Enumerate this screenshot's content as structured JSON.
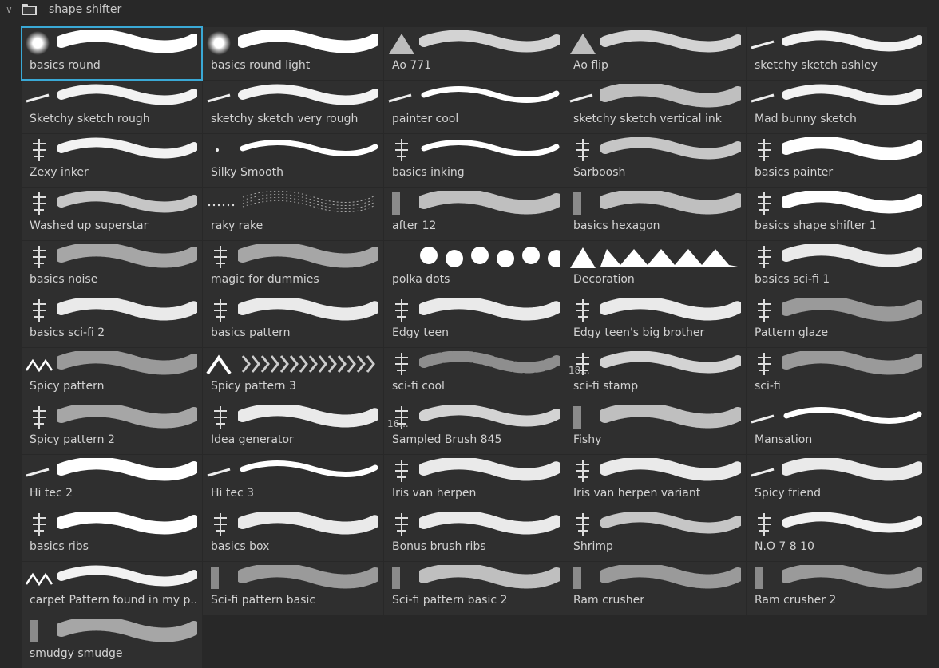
{
  "folder": {
    "title": "shape shifter",
    "expanded": true,
    "icon": "folder-icon",
    "chevron_icon": "chevron-down-icon"
  },
  "selected_index": 0,
  "accent_color": "#3aa9d6",
  "brushes": [
    {
      "name": "basics round",
      "tip": "soft-round",
      "stroke": "solid"
    },
    {
      "name": "basics round light",
      "tip": "soft-round",
      "stroke": "solid"
    },
    {
      "name": "Ao 771",
      "tip": "triangle",
      "stroke": "soft"
    },
    {
      "name": "Ao flip",
      "tip": "triangle",
      "stroke": "soft"
    },
    {
      "name": "sketchy sketch ashley",
      "tip": "sketch",
      "stroke": "rough"
    },
    {
      "name": "Sketchy sketch rough",
      "tip": "sketch",
      "stroke": "rough"
    },
    {
      "name": "sketchy sketch very rough",
      "tip": "sketch",
      "stroke": "rough"
    },
    {
      "name": "painter cool",
      "tip": "sketch",
      "stroke": "thin"
    },
    {
      "name": "sketchy sketch vertical ink",
      "tip": "sketch",
      "stroke": "speckle"
    },
    {
      "name": "Mad bunny sketch",
      "tip": "sketch",
      "stroke": "rough"
    },
    {
      "name": "Zexy inker",
      "tip": "glyph",
      "stroke": "rough"
    },
    {
      "name": "Silky Smooth",
      "tip": "dot",
      "stroke": "thin"
    },
    {
      "name": "basics inking",
      "tip": "glyph",
      "stroke": "thin"
    },
    {
      "name": "Sarboosh",
      "tip": "glyph",
      "stroke": "streaks"
    },
    {
      "name": "basics painter",
      "tip": "glyph",
      "stroke": "solid"
    },
    {
      "name": "Washed up superstar",
      "tip": "glyph",
      "stroke": "streaks"
    },
    {
      "name": "raky rake",
      "tip": "dots-row",
      "stroke": "rake"
    },
    {
      "name": "after 12",
      "tip": "texture",
      "stroke": "speckle"
    },
    {
      "name": "basics hexagon",
      "tip": "texture",
      "stroke": "speckle"
    },
    {
      "name": "basics shape shifter 1",
      "tip": "glyph",
      "stroke": "solid"
    },
    {
      "name": "basics noise",
      "tip": "glyph",
      "stroke": "noise"
    },
    {
      "name": "magic for dummies",
      "tip": "glyph",
      "stroke": "noise"
    },
    {
      "name": "polka dots",
      "tip": "none",
      "stroke": "dots"
    },
    {
      "name": "Decoration",
      "tip": "triangle-solid",
      "stroke": "zigzag"
    },
    {
      "name": "basics sci-fi 1",
      "tip": "glyph",
      "stroke": "pattern"
    },
    {
      "name": "basics sci-fi 2",
      "tip": "glyph",
      "stroke": "pattern"
    },
    {
      "name": "basics pattern",
      "tip": "glyph",
      "stroke": "pattern"
    },
    {
      "name": "Edgy teen",
      "tip": "glyph",
      "stroke": "pattern"
    },
    {
      "name": "Edgy teen's big brother",
      "tip": "glyph",
      "stroke": "pattern"
    },
    {
      "name": "Pattern glaze",
      "tip": "glyph",
      "stroke": "pattern-soft"
    },
    {
      "name": "Spicy pattern",
      "tip": "zigzag",
      "stroke": "pattern-soft"
    },
    {
      "name": "Spicy pattern 3",
      "tip": "chevron",
      "stroke": "chevrons"
    },
    {
      "name": "sci-fi cool",
      "tip": "glyph",
      "stroke": "dots-soft"
    },
    {
      "name": "sci-fi stamp",
      "tip": "glyph",
      "stroke": "soft",
      "tip_number": "18..."
    },
    {
      "name": "sci-fi",
      "tip": "glyph",
      "stroke": "pattern-soft"
    },
    {
      "name": "Spicy pattern 2",
      "tip": "glyph",
      "stroke": "noise"
    },
    {
      "name": "Idea generator",
      "tip": "glyph",
      "stroke": "pattern"
    },
    {
      "name": "Sampled Brush 845",
      "tip": "glyph",
      "stroke": "soft",
      "tip_number": "16..."
    },
    {
      "name": "Fishy",
      "tip": "texture",
      "stroke": "speckle"
    },
    {
      "name": "Mansation",
      "tip": "sketch",
      "stroke": "thin"
    },
    {
      "name": "Hi tec 2",
      "tip": "sketch",
      "stroke": "solid"
    },
    {
      "name": "Hi tec 3",
      "tip": "sketch",
      "stroke": "thin"
    },
    {
      "name": "Iris van herpen",
      "tip": "glyph",
      "stroke": "pattern"
    },
    {
      "name": "Iris van herpen variant",
      "tip": "glyph",
      "stroke": "pattern"
    },
    {
      "name": "Spicy friend",
      "tip": "sketch",
      "stroke": "pattern"
    },
    {
      "name": "basics ribs",
      "tip": "glyph",
      "stroke": "solid"
    },
    {
      "name": "basics box",
      "tip": "glyph",
      "stroke": "pattern"
    },
    {
      "name": "Bonus brush ribs",
      "tip": "glyph",
      "stroke": "pattern"
    },
    {
      "name": "Shrimp",
      "tip": "glyph",
      "stroke": "streaks"
    },
    {
      "name": "N.O 7 8 10",
      "tip": "glyph",
      "stroke": "rough"
    },
    {
      "name": "carpet Pattern found in my p...",
      "tip": "zigzag",
      "stroke": "rough"
    },
    {
      "name": "Sci-fi pattern basic",
      "tip": "texture",
      "stroke": "pattern-soft"
    },
    {
      "name": "Sci-fi pattern basic 2",
      "tip": "texture",
      "stroke": "speckle"
    },
    {
      "name": "Ram crusher",
      "tip": "texture",
      "stroke": "pattern-soft"
    },
    {
      "name": "Ram crusher 2",
      "tip": "texture",
      "stroke": "pattern-soft"
    },
    {
      "name": "smudgy smudge",
      "tip": "texture",
      "stroke": "noise"
    }
  ]
}
